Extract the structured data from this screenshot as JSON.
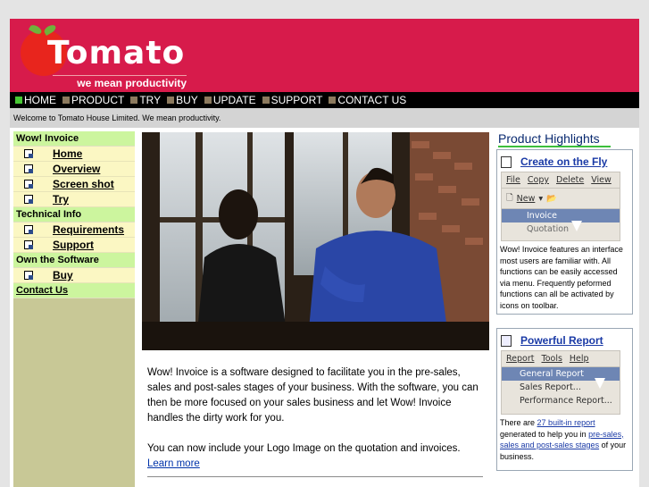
{
  "brand": {
    "name": "Tomato",
    "tagline": "we mean productivity"
  },
  "nav": {
    "items": [
      {
        "label": "HOME",
        "active": true
      },
      {
        "label": "PRODUCT"
      },
      {
        "label": "TRY"
      },
      {
        "label": "BUY"
      },
      {
        "label": "UPDATE"
      },
      {
        "label": "SUPPORT"
      },
      {
        "label": "CONTACT US"
      }
    ]
  },
  "welcome": "Welcome to Tomato House Limited. We mean productivity.",
  "sidebar": {
    "sections": [
      {
        "title": "Wow! Invoice",
        "items": [
          "Home",
          "Overview",
          "Screen shot",
          "Try"
        ]
      },
      {
        "title": "Technical Info",
        "items": [
          "Requirements",
          "Support"
        ]
      },
      {
        "title": "Own the Software",
        "items": [
          "Buy"
        ]
      }
    ],
    "contact": "Contact Us"
  },
  "main": {
    "para1": "Wow! Invoice is a software designed to facilitate you in the pre-sales, sales and post-sales stages of your business. With the software, you can then be more focused on your sales business and let Wow! Invoice handles the dirty work for you.",
    "para2": "You can now include your Logo Image on the quotation and invoices.",
    "learn_more": "Learn more"
  },
  "highlights": {
    "title": "Product Highlights",
    "fly": {
      "title": "Create on the Fly",
      "menu": [
        "File",
        "Copy",
        "Delete",
        "View"
      ],
      "new_label": "New",
      "items": [
        "Invoice",
        "Quotation"
      ],
      "text": "Wow! Invoice features an interface most users are familiar with. All functions can be easily accessed via menu. Frequently peformed functions can all be activated by icons on toolbar."
    },
    "report": {
      "title": "Powerful Report",
      "menu": [
        "Report",
        "Tools",
        "Help"
      ],
      "items": [
        "General Report",
        "Sales Report...",
        "Performance Report..."
      ],
      "text_before": "There are",
      "link1": "27 built-in report",
      "text_mid": "generated to help you in",
      "link2": "pre-sales, sales and post-sales stages",
      "text_after": "of your business."
    }
  },
  "colors": {
    "banner": "#d71b4b",
    "nav_bg": "#000000",
    "sidebar_head": "#ccf59e",
    "sidebar_item": "#fbf7c3",
    "accent_link": "#1a3aa6"
  }
}
